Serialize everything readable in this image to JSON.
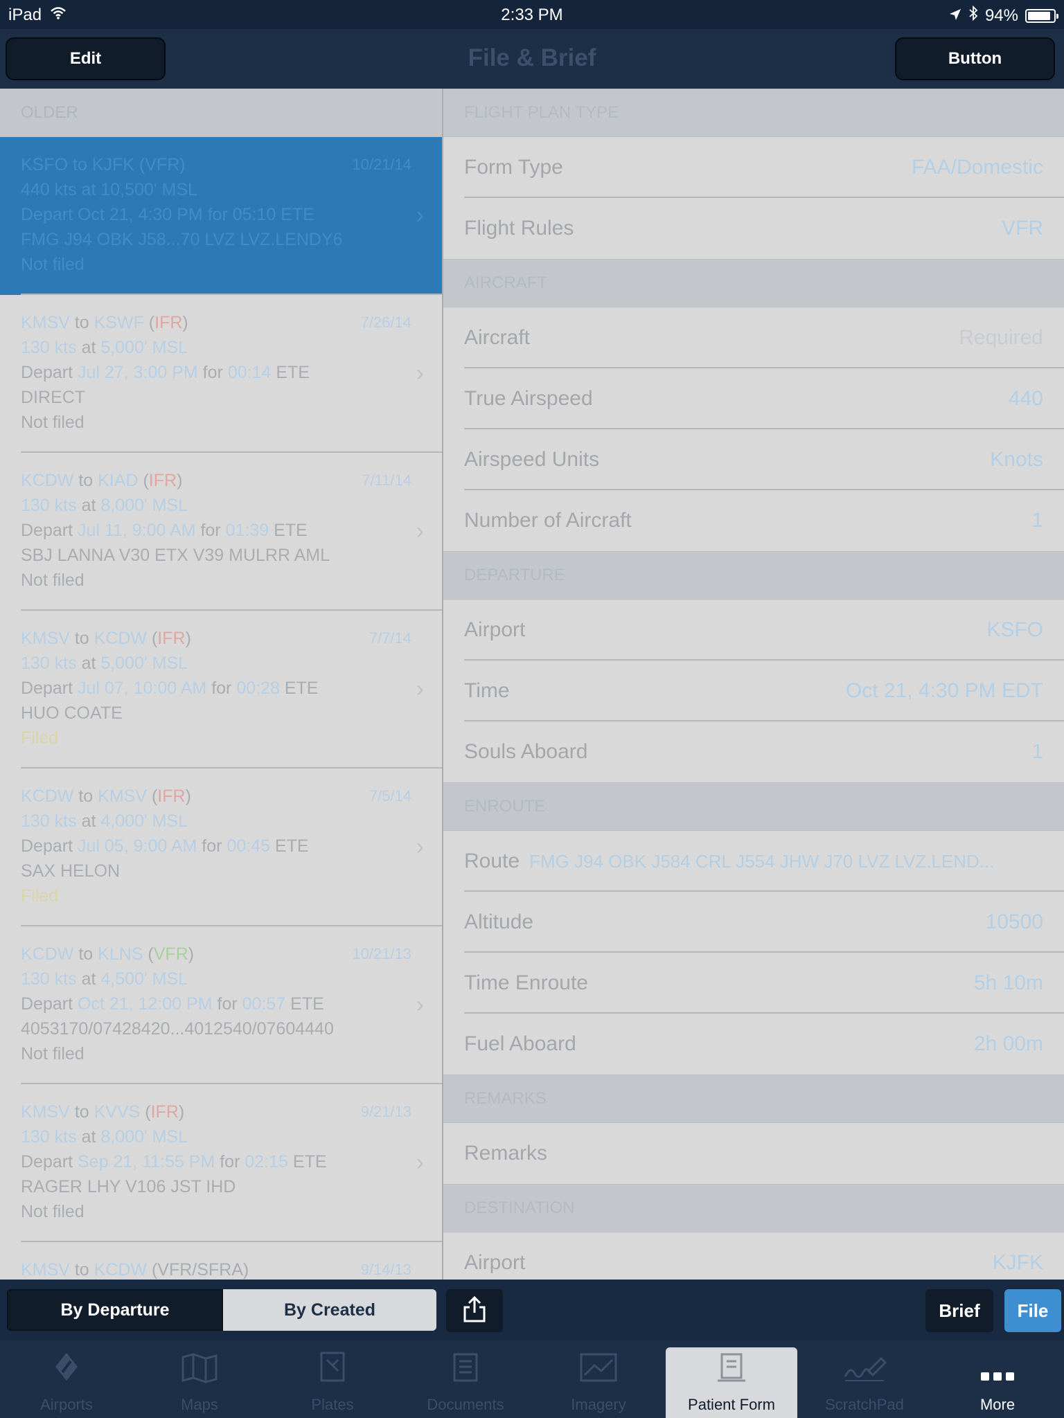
{
  "status_bar": {
    "device": "iPad",
    "time": "2:33 PM",
    "battery": "94%"
  },
  "nav": {
    "title": "File & Brief",
    "left_button": "Edit",
    "right_button": "Button"
  },
  "list": {
    "section": "OLDER",
    "plans": [
      {
        "from": "KSFO",
        "to": "KJFK",
        "rules": "VFR",
        "rules_color": "default",
        "date": "10/21/14",
        "speed": "440 kts",
        "alt": "10,500' MSL",
        "depart": "Oct 21, 4:30 PM",
        "ete": "05:10",
        "route": "FMG J94 OBK J58...70 LVZ LVZ.LENDY6",
        "status": "Not filed",
        "status_color": "default",
        "selected": true
      },
      {
        "from": "KMSV",
        "to": "KSWF",
        "rules": "IFR",
        "rules_color": "red",
        "date": "7/26/14",
        "speed": "130 kts",
        "alt": "5,000' MSL",
        "depart": "Jul 27, 3:00 PM",
        "ete": "00:14",
        "route": "DIRECT",
        "status": "Not filed",
        "status_color": "default",
        "selected": false
      },
      {
        "from": "KCDW",
        "to": "KIAD",
        "rules": "IFR",
        "rules_color": "red",
        "date": "7/11/14",
        "speed": "130 kts",
        "alt": "8,000' MSL",
        "depart": "Jul 11, 9:00 AM",
        "ete": "01:39",
        "route": "SBJ LANNA V30 ETX V39 MULRR AML",
        "status": "Not filed",
        "status_color": "default",
        "selected": false
      },
      {
        "from": "KMSV",
        "to": "KCDW",
        "rules": "IFR",
        "rules_color": "red",
        "date": "7/7/14",
        "speed": "130 kts",
        "alt": "5,000' MSL",
        "depart": "Jul 07, 10:00 AM",
        "ete": "00:28",
        "route": "HUO COATE",
        "status": "Filed",
        "status_color": "yellow",
        "selected": false
      },
      {
        "from": "KCDW",
        "to": "KMSV",
        "rules": "IFR",
        "rules_color": "red",
        "date": "7/5/14",
        "speed": "130 kts",
        "alt": "4,000' MSL",
        "depart": "Jul 05, 9:00 AM",
        "ete": "00:45",
        "route": "SAX HELON",
        "status": "Filed",
        "status_color": "yellow",
        "selected": false
      },
      {
        "from": "KCDW",
        "to": "KLNS",
        "rules": "VFR",
        "rules_color": "green",
        "date": "10/21/13",
        "speed": "130 kts",
        "alt": "4,500' MSL",
        "depart": "Oct 21, 12:00 PM",
        "ete": "00:57",
        "route": "4053170/07428420...4012540/07604440",
        "status": "Not filed",
        "status_color": "default",
        "selected": false
      },
      {
        "from": "KMSV",
        "to": "KVVS",
        "rules": "IFR",
        "rules_color": "red",
        "date": "9/21/13",
        "speed": "130 kts",
        "alt": "8,000' MSL",
        "depart": "Sep 21, 11:55 PM",
        "ete": "02:15",
        "route": "RAGER LHY V106 JST IHD",
        "status": "Not filed",
        "status_color": "default",
        "selected": false
      },
      {
        "from": "KMSV",
        "to": "KCDW",
        "rules": "VFR/SFRA",
        "rules_color": "default",
        "date": "9/14/13",
        "speed": "",
        "alt": "",
        "depart": "",
        "ete": "",
        "route": "",
        "status": "",
        "status_color": "default",
        "selected": false
      }
    ],
    "words": {
      "to": "to",
      "at": "at",
      "depart": "Depart",
      "for": "for",
      "ete": "ETE"
    }
  },
  "form": {
    "sections": [
      {
        "title": "FLIGHT PLAN TYPE",
        "rows": [
          {
            "label": "Form Type",
            "value": "FAA/Domestic"
          },
          {
            "label": "Flight Rules",
            "value": "VFR"
          }
        ]
      },
      {
        "title": "AIRCRAFT",
        "rows": [
          {
            "label": "Aircraft",
            "value": "Required",
            "placeholder": true
          },
          {
            "label": "True Airspeed",
            "value": "440"
          },
          {
            "label": "Airspeed Units",
            "value": "Knots"
          },
          {
            "label": "Number of Aircraft",
            "value": "1"
          }
        ]
      },
      {
        "title": "DEPARTURE",
        "rows": [
          {
            "label": "Airport",
            "value": "KSFO"
          },
          {
            "label": "Time",
            "value": "Oct 21, 4:30 PM EDT"
          },
          {
            "label": "Souls Aboard",
            "value": "1"
          }
        ]
      },
      {
        "title": "ENROUTE",
        "rows": [
          {
            "label": "Route",
            "value": "FMG J94 OBK J584 CRL J554 JHW J70 LVZ LVZ.LEND...",
            "inline": true
          },
          {
            "label": "Altitude",
            "value": "10500"
          },
          {
            "label": "Time Enroute",
            "value": "5h 10m"
          },
          {
            "label": "Fuel Aboard",
            "value": "2h 00m"
          }
        ]
      },
      {
        "title": "REMARKS",
        "rows": [
          {
            "label": "Remarks",
            "value": ""
          }
        ]
      },
      {
        "title": "DESTINATION",
        "rows": [
          {
            "label": "Airport",
            "value": "KJFK"
          }
        ]
      }
    ]
  },
  "toolbar": {
    "by_departure": "By Departure",
    "by_created": "By Created",
    "brief": "Brief",
    "file": "File"
  },
  "tabs": [
    {
      "label": "Airports",
      "icon": "airport-icon",
      "active": false
    },
    {
      "label": "Maps",
      "icon": "map-icon",
      "active": false
    },
    {
      "label": "Plates",
      "icon": "plates-icon",
      "active": false
    },
    {
      "label": "Documents",
      "icon": "documents-icon",
      "active": false
    },
    {
      "label": "Imagery",
      "icon": "imagery-icon",
      "active": false
    },
    {
      "label": "Patient Form",
      "icon": "form-icon",
      "active": true
    },
    {
      "label": "ScratchPad",
      "icon": "scratchpad-icon",
      "active": false
    },
    {
      "label": "More",
      "icon": "more-icon",
      "active": false
    }
  ]
}
